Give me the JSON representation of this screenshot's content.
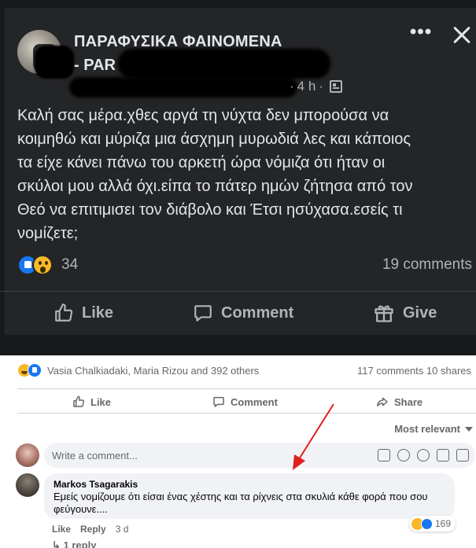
{
  "post": {
    "page_name_line1": "ΠΑΡΑΦΥΣΙΚΑ ΦΑΙΝΟΜΕΝΑ",
    "page_name_line2": "- PAR",
    "time": "4 h",
    "more_icon": "more-icon",
    "close_icon": "close-icon",
    "text_lines": [
      "Καλή σας μέρα.χθες αργά τη νύχτα δεν μπορούσα να",
      "κοιμηθώ και μύριζα μια άσχημη μυρωδιά λες και κάποιος",
      "τα είχε κάνει πάνω του αρκετή ώρα νόμιζα ότι ήταν οι",
      "σκύλοι μου αλλά όχι.είπα το πάτερ ημών ζήτησα από τον",
      "Θεό να επιτιμισει τον διάβολο και Έτσι ησύχασα.εσείς τι",
      "νομίζετε;"
    ],
    "reaction_count": "34",
    "comments": "19 comments",
    "actions": {
      "like": "Like",
      "comment": "Comment",
      "give": "Give"
    }
  },
  "embedded": {
    "reactors": "Vasia Chalkiadaki, Maria Rizou and 392 others",
    "stats": "117 comments  10 shares",
    "actions": {
      "like": "Like",
      "comment": "Comment",
      "share": "Share"
    },
    "sort_label": "Most relevant",
    "input_placeholder": "Write a comment...",
    "comment": {
      "author": "Markos Tsagarakis",
      "text": "Εμείς νομίζουμε ότι είσαι ένας χέστης και τα ρίχνεις στα σκυλιά κάθε φορά που σου φεύγουνε....",
      "reaction_count": "169",
      "like": "Like",
      "reply": "Reply",
      "time": "3 d",
      "replies": "1 reply"
    }
  },
  "colors": {
    "dark_bg": "#242526",
    "dark_text": "#e4e6eb",
    "dark_secondary": "#b0b3b8",
    "facebook_blue": "#1877f2",
    "annotation_arrow": "#e02020"
  }
}
